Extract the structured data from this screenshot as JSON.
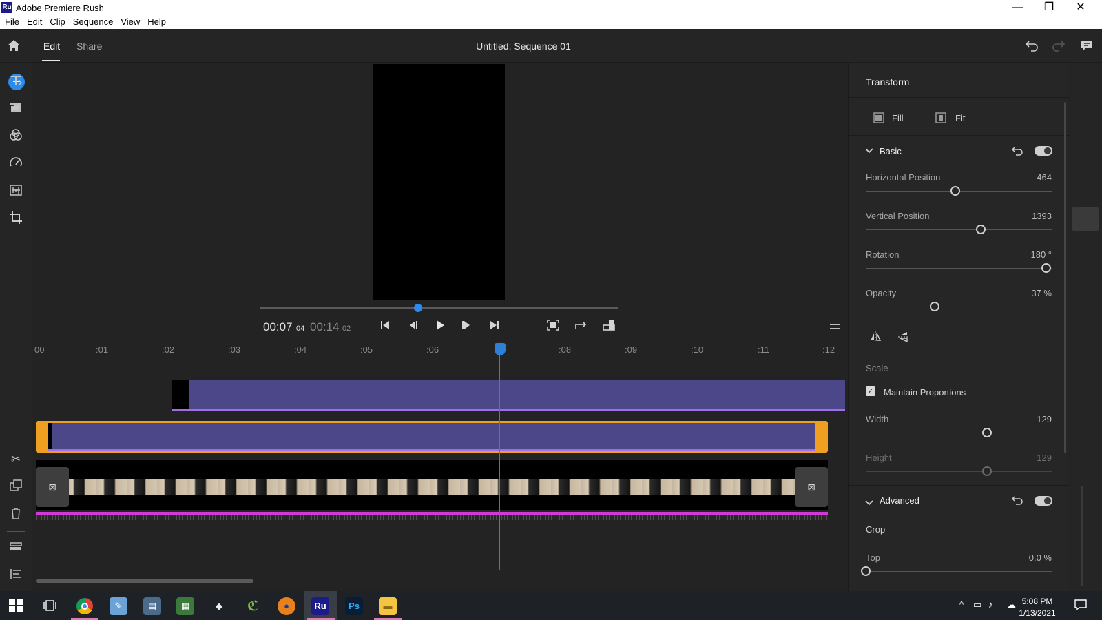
{
  "window": {
    "app_icon": "Ru",
    "title": "Adobe Premiere Rush",
    "minimize": "—",
    "maximize": "❐",
    "close": "✕"
  },
  "menu": [
    "File",
    "Edit",
    "Clip",
    "Sequence",
    "View",
    "Help"
  ],
  "header": {
    "tabs": [
      {
        "label": "Edit",
        "active": true
      },
      {
        "label": "Share",
        "active": false
      }
    ],
    "sequence_title": "Untitled: Sequence 01",
    "icons": [
      "home-icon",
      "undo-icon",
      "redo-icon",
      "comment-icon"
    ]
  },
  "left_rail": {
    "icons": [
      "add-media-icon",
      "media-bin-icon",
      "split-icon",
      "duplicate-icon",
      "delete-icon",
      "track-controls-icon",
      "timeline-options-icon"
    ]
  },
  "player": {
    "current_time": "00:07",
    "current_frames": "04",
    "duration_time": "00:14",
    "duration_frames": "02",
    "scrub_progress": 0.44,
    "controls": [
      "skip-to-start-icon",
      "step-back-icon",
      "play-icon",
      "step-forward-icon",
      "skip-to-end-icon"
    ],
    "view_controls": [
      "fullscreen-icon",
      "loop-icon",
      "aspect-ratio-icon"
    ]
  },
  "timeline": {
    "ruler_ticks": [
      "00",
      ":01",
      ":02",
      ":03",
      ":04",
      ":05",
      ":06",
      "",
      ":08",
      ":09",
      ":10",
      ":11",
      ":12"
    ],
    "playhead_time": 7.04,
    "track_color": "#4c4788",
    "selected_color": "#f0a020",
    "audio_color": "#d23ad6"
  },
  "transform_panel": {
    "title": "Transform",
    "fill_label": "Fill",
    "fit_label": "Fit",
    "basic_label": "Basic",
    "basic_enabled": true,
    "properties": [
      {
        "label": "Horizontal Position",
        "value": "464",
        "position": 0.48
      },
      {
        "label": "Vertical Position",
        "value": "1393",
        "position": 0.62
      },
      {
        "label": "Rotation",
        "value": "180 °",
        "position": 0.97
      },
      {
        "label": "Opacity",
        "value": "37 %",
        "position": 0.37
      }
    ],
    "scale_label": "Scale",
    "maintain_proportions_label": "Maintain Proportions",
    "maintain_proportions": true,
    "width_label": "Width",
    "width_value": "129",
    "width_position": 0.65,
    "height_label": "Height",
    "height_value": "129",
    "height_position": 0.65,
    "advanced_label": "Advanced",
    "advanced_enabled": true,
    "crop_label": "Crop",
    "top_label": "Top",
    "top_value": "0.0 %",
    "top_position": 0.0
  },
  "right_rail": {
    "icons": [
      "titles-icon",
      "transitions-icon",
      "color-icon",
      "speed-icon",
      "audio-icon",
      "transform-icon"
    ]
  },
  "taskbar": {
    "apps": [
      "start-icon",
      "task-view-icon",
      "chrome-icon",
      "paint-icon",
      "file-app-icon",
      "calculator-icon",
      "inkscape-icon",
      "app-green-icon",
      "app-orange-icon",
      "premiere-rush-icon",
      "photoshop-icon",
      "file-explorer-icon"
    ],
    "rush_label": "Ru",
    "ps_label": "Ps",
    "time": "5:08 PM",
    "date": "1/13/2021"
  }
}
